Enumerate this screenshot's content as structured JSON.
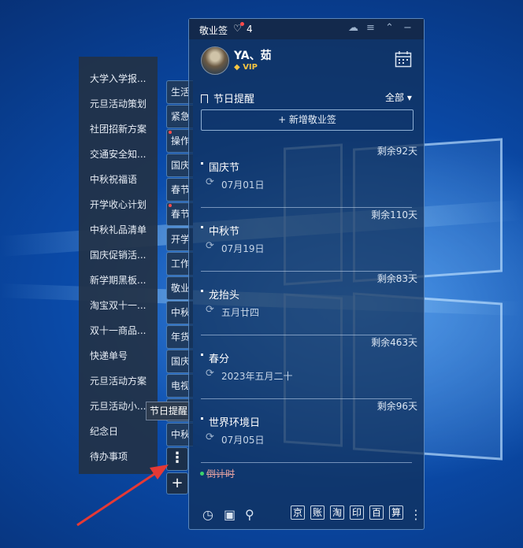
{
  "left_list": [
    "大学入学报...",
    "元旦活动策划",
    "社团招新方案",
    "交通安全知...",
    "中秋祝福语",
    "开学收心计划",
    "中秋礼品清单",
    "国庆促销活...",
    "新学期黑板...",
    "淘宝双十一...",
    "双十一商品...",
    "快递单号",
    "元旦活动方案",
    "元旦活动小...",
    "纪念日",
    "待办事项"
  ],
  "tabs": [
    "生活",
    "紧急",
    "操作",
    "国庆",
    "春节",
    "春节",
    "开学",
    "工作",
    "敬业",
    "中秋",
    "年货",
    "国庆",
    "电视",
    "中秋",
    "中秋"
  ],
  "more_icon": "⋮",
  "add_icon": "+",
  "tooltip": "节日提醒",
  "window": {
    "app_name": "敬业签",
    "notification_count": "4",
    "user_name": "YA、茹",
    "vip_label": "VIP",
    "section_title": "节日提醒",
    "filter_label": "全部 ▾",
    "add_note_label": "+ 新增敬业签",
    "items": [
      {
        "name": "国庆节",
        "date": "07月01日",
        "remaining": "剩余92天"
      },
      {
        "name": "中秋节",
        "date": "07月19日",
        "remaining": "剩余110天"
      },
      {
        "name": "龙抬头",
        "date": "五月廿四",
        "remaining": "剩余83天"
      },
      {
        "name": "春分",
        "date": "2023年五月二十",
        "remaining": "剩余463天"
      },
      {
        "name": "世界环境日",
        "date": "07月05日",
        "remaining": "剩余96天"
      }
    ],
    "countdown_label": "倒计时",
    "bottom_shortcuts": [
      "京",
      "账",
      "淘",
      "印",
      "百",
      "算"
    ]
  },
  "colors": {
    "accent": "#5a86ba",
    "badge": "#ff4b4b",
    "vip": "#f5c542",
    "arrow": "#e53935"
  }
}
